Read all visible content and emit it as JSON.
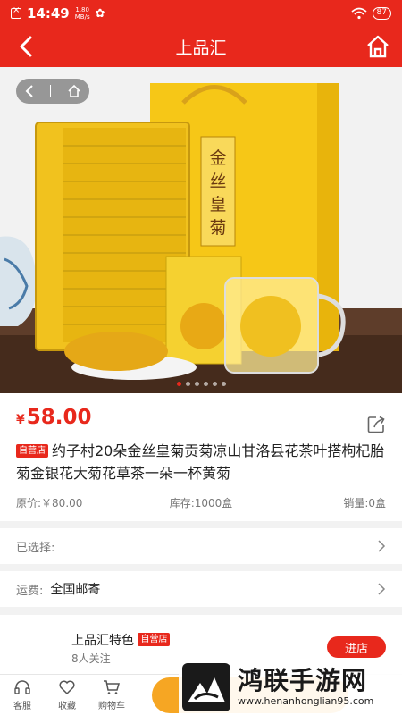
{
  "status_bar": {
    "time": "14:49",
    "speed_value": "1.80",
    "speed_unit": "MB/s",
    "battery": "87"
  },
  "header": {
    "title": "上品汇",
    "back_icon": "chevron-left-icon",
    "home_icon": "home-icon"
  },
  "hero": {
    "nav_back_icon": "chevron-left-icon",
    "nav_home_icon": "home-icon",
    "package_text": "金丝皇菊",
    "dots_total": 6,
    "dots_active": 0
  },
  "product": {
    "currency": "¥",
    "price": "58.00",
    "tag": "自营店",
    "title": "约子村20朵金丝皇菊贡菊凉山甘洛县花茶叶搭枸杞胎菊金银花大菊花草茶一朵一杯黄菊",
    "original_price": "原价:￥80.00",
    "stock": "库存:1000盒",
    "sales": "销量:0盒"
  },
  "selection": {
    "label": "已选择:"
  },
  "shipping": {
    "label": "运费:",
    "value": "全国邮寄"
  },
  "shop": {
    "name": "上品汇特色",
    "tag": "自营店",
    "followers": "8人关注",
    "enter_button": "进店"
  },
  "bottom_bar": {
    "service": "客服",
    "favorite": "收藏",
    "cart": "购物车"
  },
  "watermark": {
    "brand": "鸿联手游网",
    "url": "www.henanhonglian95.com"
  },
  "colors": {
    "primary": "#e8281c",
    "cta": "#f6a623"
  }
}
